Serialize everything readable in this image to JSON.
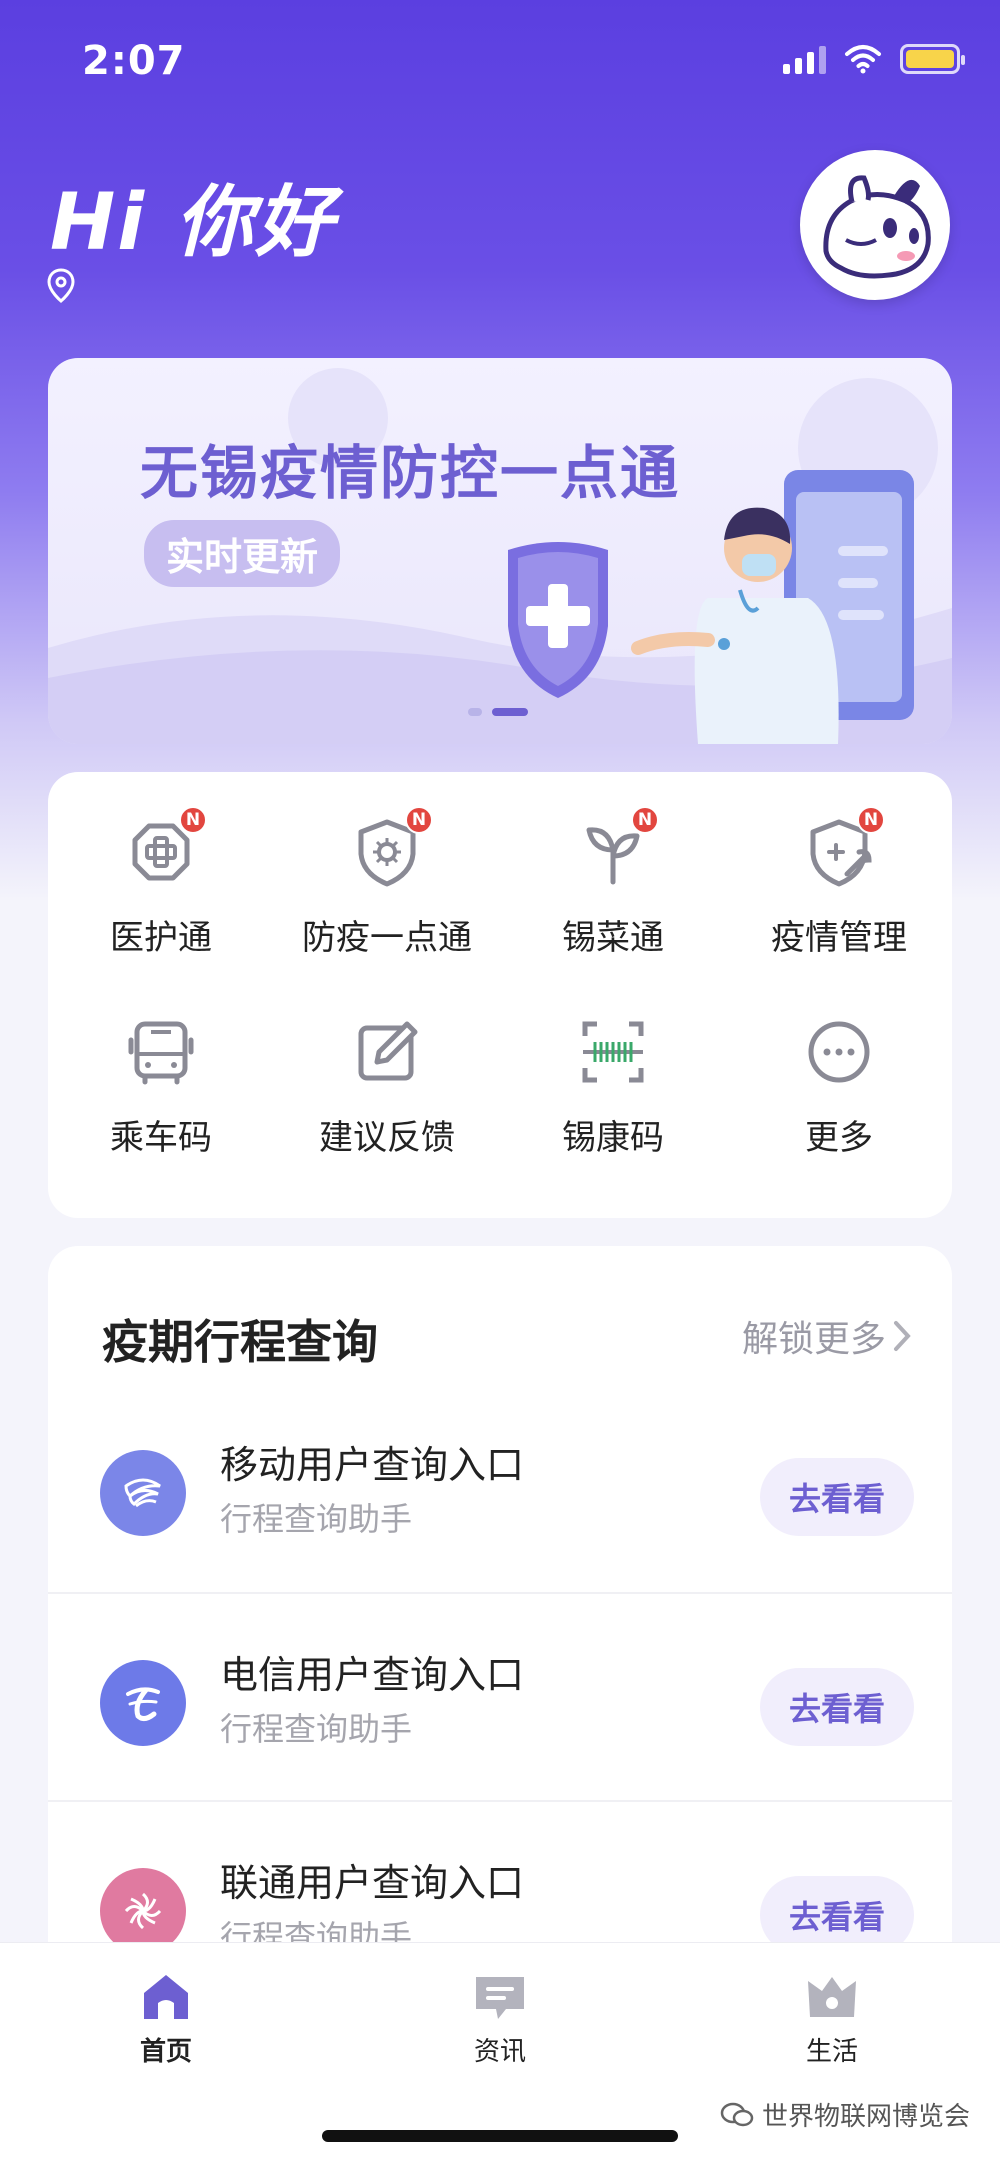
{
  "status": {
    "time": "2:07"
  },
  "header": {
    "greeting": "Hi 你好"
  },
  "banner": {
    "title": "无锡疫情防控一点通",
    "tag": "实时更新",
    "active_slide": 2,
    "slide_count": 2
  },
  "services": [
    {
      "label": "医护通",
      "icon": "medical-cross-icon",
      "badge": "N"
    },
    {
      "label": "防疫一点通",
      "icon": "virus-shield-icon",
      "badge": "N"
    },
    {
      "label": "锡菜通",
      "icon": "sprout-icon",
      "badge": "N"
    },
    {
      "label": "疫情管理",
      "icon": "shield-wrench-icon",
      "badge": "N"
    },
    {
      "label": "乘车码",
      "icon": "bus-icon",
      "badge": ""
    },
    {
      "label": "建议反馈",
      "icon": "edit-icon",
      "badge": ""
    },
    {
      "label": "锡康码",
      "icon": "barcode-scan-icon",
      "badge": ""
    },
    {
      "label": "更多",
      "icon": "more-icon",
      "badge": ""
    }
  ],
  "query": {
    "title": "疫期行程查询",
    "more_label": "解锁更多",
    "rows": [
      {
        "title": "移动用户查询入口",
        "subtitle": "行程查询助手",
        "button": "去看看",
        "logo": "china-mobile-logo",
        "color": "#7b86e8"
      },
      {
        "title": "电信用户查询入口",
        "subtitle": "行程查询助手",
        "button": "去看看",
        "logo": "china-telecom-logo",
        "color": "#6d7ae8"
      },
      {
        "title": "联通用户查询入口",
        "subtitle": "行程查询助手",
        "button": "去看看",
        "logo": "china-unicom-logo",
        "color": "#e07aa0"
      }
    ]
  },
  "tabbar": {
    "items": [
      {
        "label": "首页",
        "icon": "home-icon",
        "active": true
      },
      {
        "label": "资讯",
        "icon": "message-icon",
        "active": false
      },
      {
        "label": "生活",
        "icon": "crown-icon",
        "active": false
      }
    ]
  },
  "watermark": "世界物联网博览会",
  "colors": {
    "accent": "#6d5fd1",
    "icon_gray": "#8a8a95",
    "badge_red": "#e2463f"
  }
}
